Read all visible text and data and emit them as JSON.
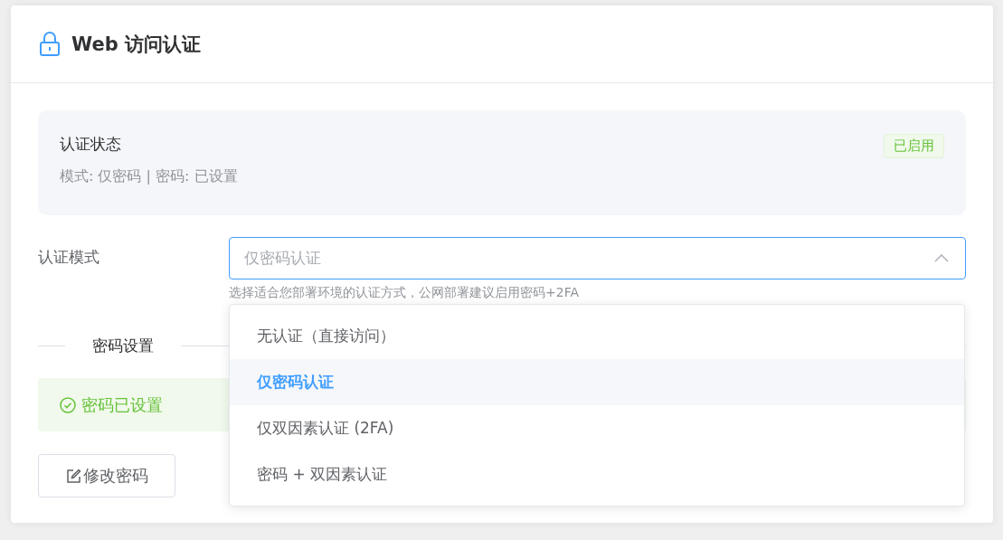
{
  "card": {
    "title": "Web 访问认证"
  },
  "status": {
    "title": "认证状态",
    "detail": "模式: 仅密码 | 密码: 已设置",
    "badge": "已启用"
  },
  "mode": {
    "label": "认证模式",
    "value": "仅密码认证",
    "open": true,
    "hint": "选择适合您部署环境的认证方式，公网部署建议启用密码+2FA",
    "options": [
      {
        "label": "无认证（直接访问）",
        "selected": false
      },
      {
        "label": "仅密码认证",
        "selected": true
      },
      {
        "label": "仅双因素认证 (2FA)",
        "selected": false
      },
      {
        "label": "密码 + 双因素认证",
        "selected": false
      }
    ]
  },
  "password": {
    "section": "密码设置",
    "alert": "密码已设置",
    "button": "修改密码"
  }
}
